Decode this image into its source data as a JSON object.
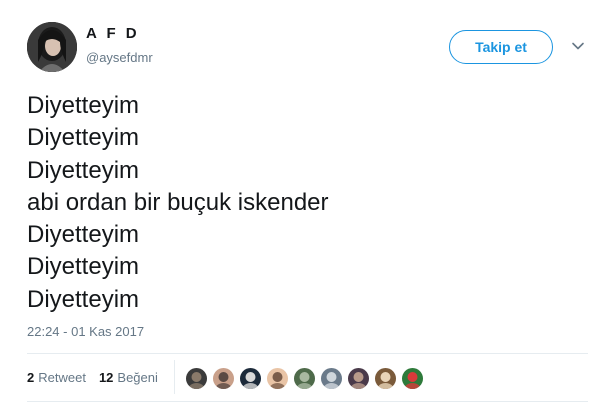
{
  "user": {
    "display_name": "A F D",
    "screen_name": "@aysefdmr"
  },
  "follow_button_label": "Takip et",
  "menu_icon": "chevron-down-icon",
  "tweet_lines": [
    "Diyetteyim",
    "Diyetteyim",
    "Diyetteyim",
    "abi ordan bir buçuk iskender",
    "Diyetteyim",
    "Diyetteyim",
    "Diyetteyim"
  ],
  "timestamp": "22:24 - 01 Kas 2017",
  "stats": {
    "retweet_count": "2",
    "retweet_label": "Retweet",
    "like_count": "12",
    "like_label": "Beğeni"
  },
  "likers": [
    {
      "colors": [
        "#3b3b3b",
        "#8a7a6a"
      ]
    },
    {
      "colors": [
        "#c9a08a",
        "#5a4a44"
      ]
    },
    {
      "colors": [
        "#1c2a3a",
        "#d8d8d8"
      ]
    },
    {
      "colors": [
        "#e9c4a6",
        "#7a5c4a"
      ]
    },
    {
      "colors": [
        "#4e6a4a",
        "#a8b8a0"
      ]
    },
    {
      "colors": [
        "#6a7a8a",
        "#cfd6dc"
      ]
    },
    {
      "colors": [
        "#4a3a4a",
        "#b89a8a"
      ]
    },
    {
      "colors": [
        "#7a5a3a",
        "#e8d4b8"
      ]
    },
    {
      "colors": [
        "#2e7a3a",
        "#d83a3a"
      ]
    }
  ],
  "colors": {
    "accent": "#1b95e0",
    "text": "#14171a",
    "muted": "#657786",
    "divider": "#e6ecf0"
  }
}
